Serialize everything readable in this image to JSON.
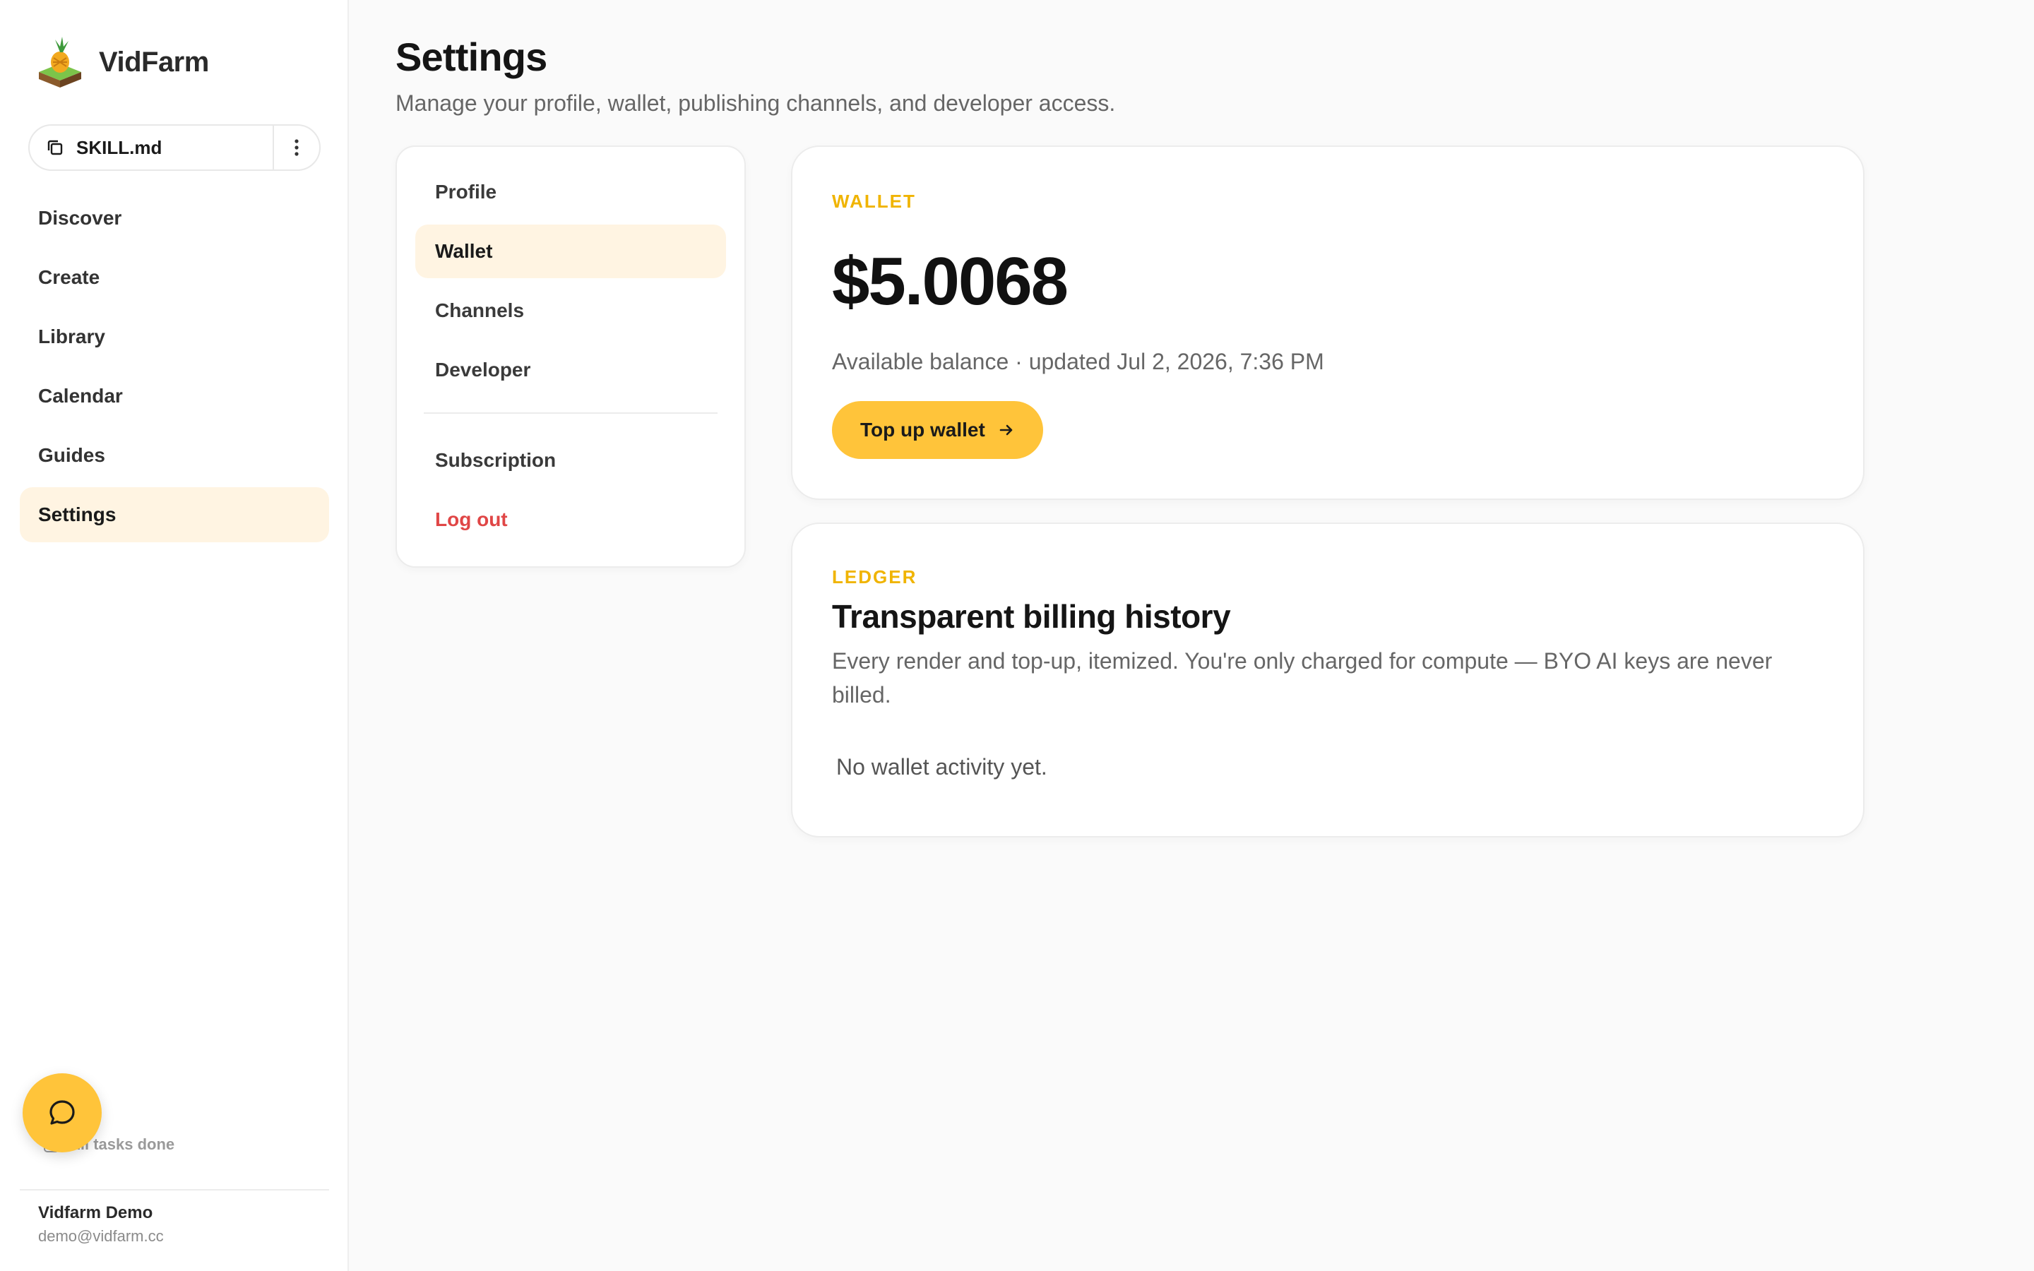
{
  "app": {
    "name": "VidFarm"
  },
  "sidebar": {
    "skill": {
      "label": "SKILL.md"
    },
    "nav": [
      {
        "label": "Discover"
      },
      {
        "label": "Create"
      },
      {
        "label": "Library"
      },
      {
        "label": "Calendar"
      },
      {
        "label": "Guides"
      },
      {
        "label": "Settings",
        "active": true
      }
    ],
    "tasks_status": "All tasks done",
    "user": {
      "name": "Vidfarm Demo",
      "email": "demo@vidfarm.cc"
    }
  },
  "page": {
    "title": "Settings",
    "subtitle": "Manage your profile, wallet, publishing channels, and developer access."
  },
  "settings_menu": {
    "items": [
      {
        "label": "Profile"
      },
      {
        "label": "Wallet",
        "active": true
      },
      {
        "label": "Channels"
      },
      {
        "label": "Developer"
      }
    ],
    "subscription": "Subscription",
    "logout": "Log out"
  },
  "wallet": {
    "eyebrow": "WALLET",
    "balance": "$5.0068",
    "meta": "Available balance · updated Jul 2, 2026, 7:36 PM",
    "topup_label": "Top up wallet"
  },
  "ledger": {
    "eyebrow": "LEDGER",
    "title": "Transparent billing history",
    "description": "Every render and top-up, itemized. You're only charged for compute — BYO AI keys are never billed.",
    "empty": "No wallet activity yet."
  },
  "colors": {
    "accent": "#ffc43a",
    "eyebrow": "#f0b400",
    "active_bg": "#fff4e2",
    "danger": "#e04646"
  }
}
